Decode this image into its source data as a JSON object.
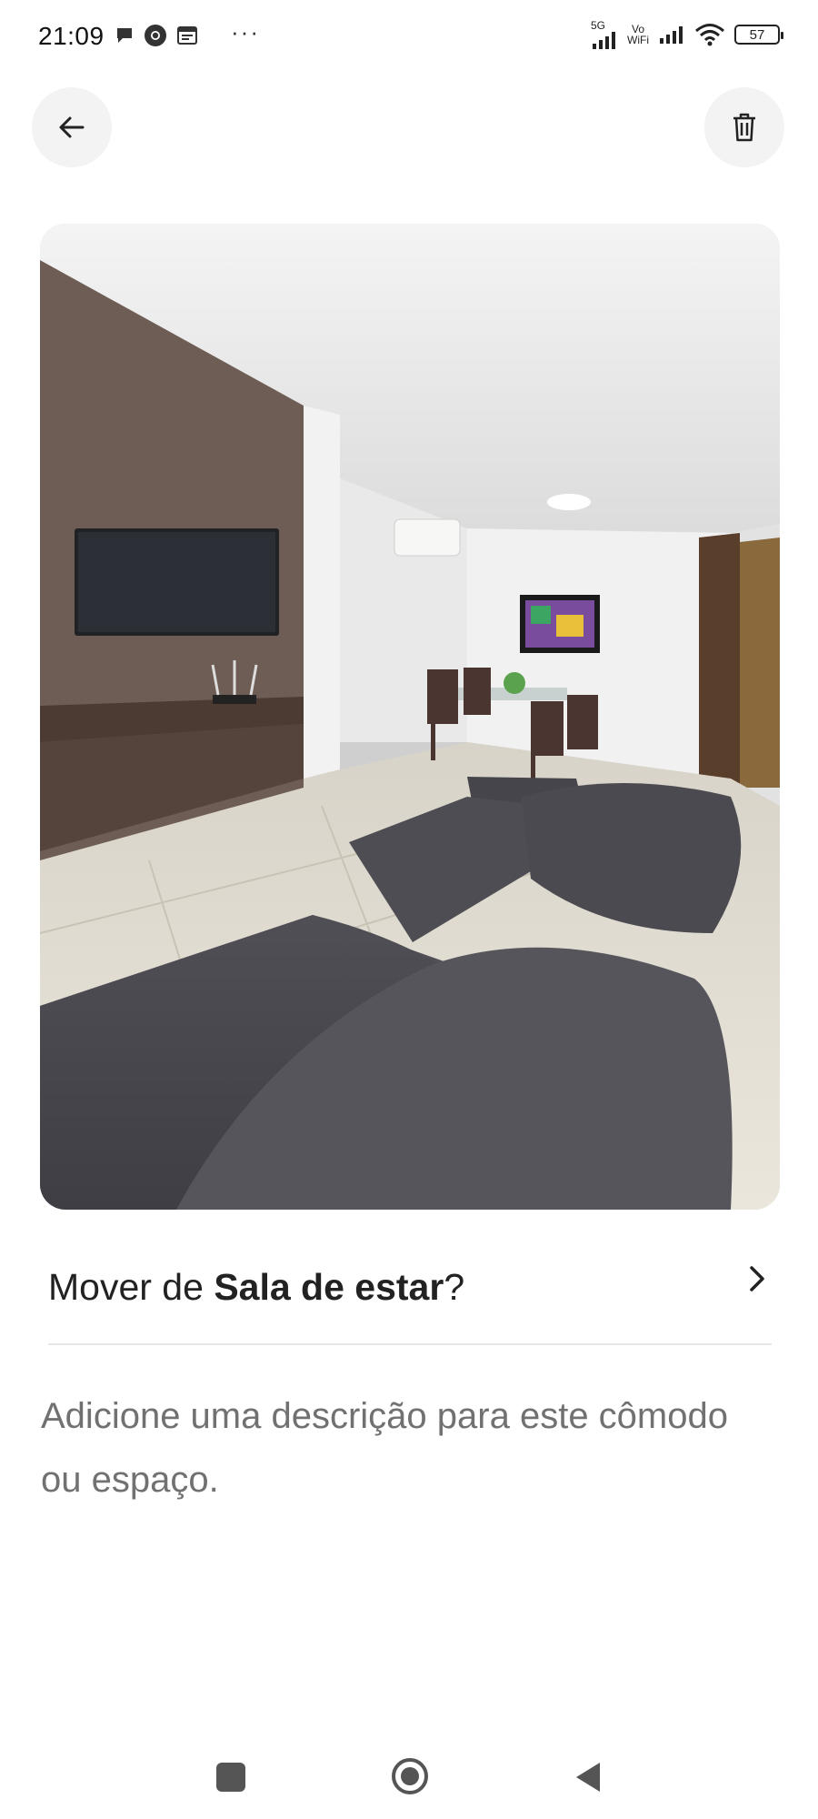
{
  "status_bar": {
    "time": "21:09",
    "left_icons": [
      "chat-bubble-icon",
      "chrome-icon",
      "calendar-icon"
    ],
    "more": "···",
    "network_5g": "5G",
    "vowifi_top": "Vo",
    "vowifi_bottom": "WiFi",
    "battery": "57"
  },
  "header": {
    "back_icon": "arrow-left-icon",
    "delete_icon": "trash-icon"
  },
  "photo": {
    "subject": "living-room-photo"
  },
  "move_row": {
    "prefix": "Mover de ",
    "room": "Sala de estar",
    "suffix": "?"
  },
  "description": {
    "placeholder": "Adicione uma descrição para este cômodo ou espaço."
  },
  "nav_bar": {
    "icons": [
      "recents-icon",
      "home-icon",
      "back-icon"
    ]
  },
  "colors": {
    "button_bg": "#f3f3f3",
    "text": "#222222",
    "muted": "#717171",
    "divider": "#e6e6e6"
  }
}
